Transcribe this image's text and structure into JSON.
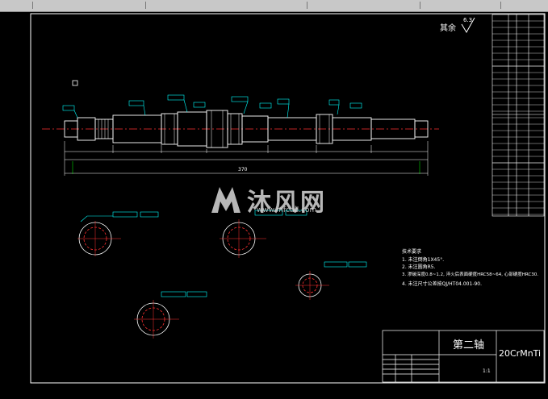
{
  "roughness_note": {
    "label": "其余",
    "value": "6.3"
  },
  "title_block": {
    "part_name": "第二轴",
    "material": "20CrMnTi",
    "scale": "1:1"
  },
  "tech_requirements": {
    "heading": "技术要求",
    "items": [
      "1. 未注倒角1X45°.",
      "2. 未注圆角R5.",
      "3. 渗碳深度0.8~1.2, 淬火后表面硬度HRC58~64, 心部硬度HRC30.",
      "4. 未注尺寸公差按QJ/HT04.001-90."
    ]
  },
  "dimensions": {
    "overall_length": "370"
  },
  "watermark": {
    "brand": "沐风网",
    "url": "www.mfcad.com"
  }
}
